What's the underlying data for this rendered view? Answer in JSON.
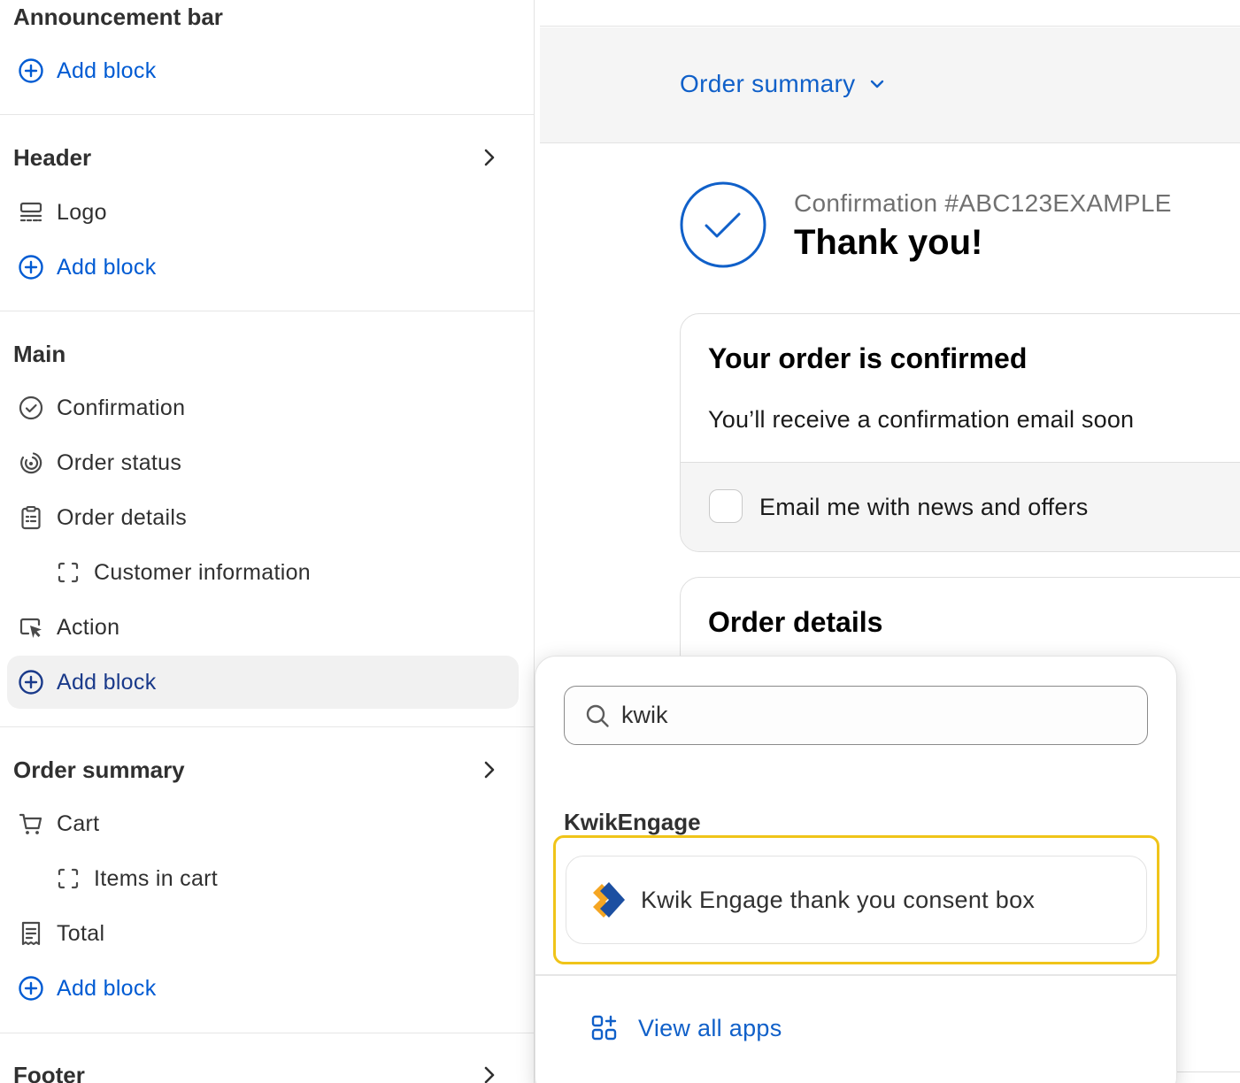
{
  "sidebar": {
    "announcement": {
      "title": "Announcement bar",
      "add_block": "Add block"
    },
    "header": {
      "title": "Header",
      "items": [
        "Logo"
      ],
      "add_block": "Add block"
    },
    "main": {
      "title": "Main",
      "items": [
        "Confirmation",
        "Order status",
        "Order details",
        "Customer information",
        "Action"
      ],
      "add_block": "Add block"
    },
    "order_summary": {
      "title": "Order summary",
      "items": [
        "Cart",
        "Items in cart",
        "Total"
      ],
      "add_block": "Add block"
    },
    "footer": {
      "title": "Footer"
    }
  },
  "preview": {
    "summary_toggle": "Order summary",
    "confirmation_number": "Confirmation #ABC123EXAMPLE",
    "thank_you": "Thank you!",
    "confirmed_card": {
      "title": "Your order is confirmed",
      "subtitle": "You’ll receive a confirmation email soon",
      "checkbox_label": "Email me with news and offers"
    },
    "details_card": {
      "title": "Order details"
    }
  },
  "popover": {
    "search_value": "kwik",
    "group_title": "KwikEngage",
    "app_item": "Kwik Engage thank you consent box",
    "view_all": "View all apps"
  },
  "colors": {
    "link_blue": "#005bd3",
    "preview_blue": "#1060c9",
    "highlight_yellow": "#f0c419",
    "kwik_orange": "#f5a623",
    "kwik_blue": "#1c4fa1"
  }
}
